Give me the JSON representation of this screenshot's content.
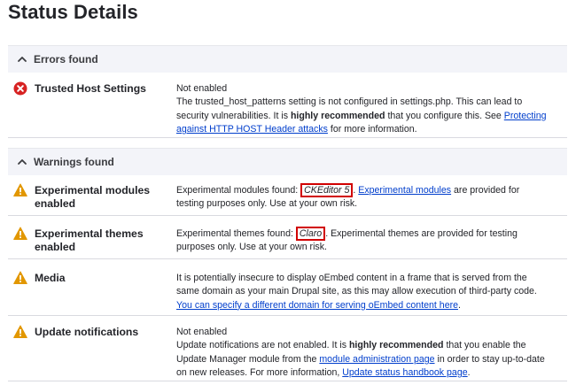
{
  "page": {
    "title": "Status Details"
  },
  "errors": {
    "header": "Errors found",
    "items": [
      {
        "title": "Trusted Host Settings",
        "status": "Not enabled",
        "text1": "The trusted_host_patterns setting is not configured in settings.php. This can lead to security vulnerabilities. It is ",
        "bold": "highly recommended",
        "text2": " that you configure this. See ",
        "link": "Protecting against HTTP HOST Header attacks",
        "text3": " for more information."
      }
    ]
  },
  "warnings": {
    "header": "Warnings found",
    "items": [
      {
        "title": "Experimental modules enabled",
        "text1": "Experimental modules found: ",
        "highlight": "CKEditor 5",
        "text2": ". ",
        "link": "Experimental modules",
        "text3": " are provided for testing purposes only. Use at your own risk."
      },
      {
        "title": "Experimental themes enabled",
        "text1": "Experimental themes found: ",
        "highlight": "Claro",
        "text2": ". Experimental themes are provided for testing purposes only. Use at your own risk."
      },
      {
        "title": "Media",
        "text1": "It is potentially insecure to display oEmbed content in a frame that is served from the same domain as your main Drupal site, as this may allow execution of third-party code. ",
        "link": "You can specify a different domain for serving oEmbed content here",
        "text2": "."
      },
      {
        "title": "Update notifications",
        "status": "Not enabled",
        "text1": "Update notifications are not enabled. It is ",
        "bold": "highly recommended",
        "text2": " that you enable the Update Manager module from the ",
        "link": "module administration page",
        "text3": " in order to stay up-to-date on new releases. For more information, ",
        "link2": "Update status handbook page",
        "text4": "."
      }
    ]
  },
  "icons": {
    "error": "error-icon",
    "warning": "warning-icon",
    "chevron": "chevron-up-icon"
  },
  "colors": {
    "error": "#d72222",
    "warning": "#e29700",
    "link": "#003ecc",
    "highlight_border": "#d10000",
    "section_bg": "#f3f4f9"
  }
}
